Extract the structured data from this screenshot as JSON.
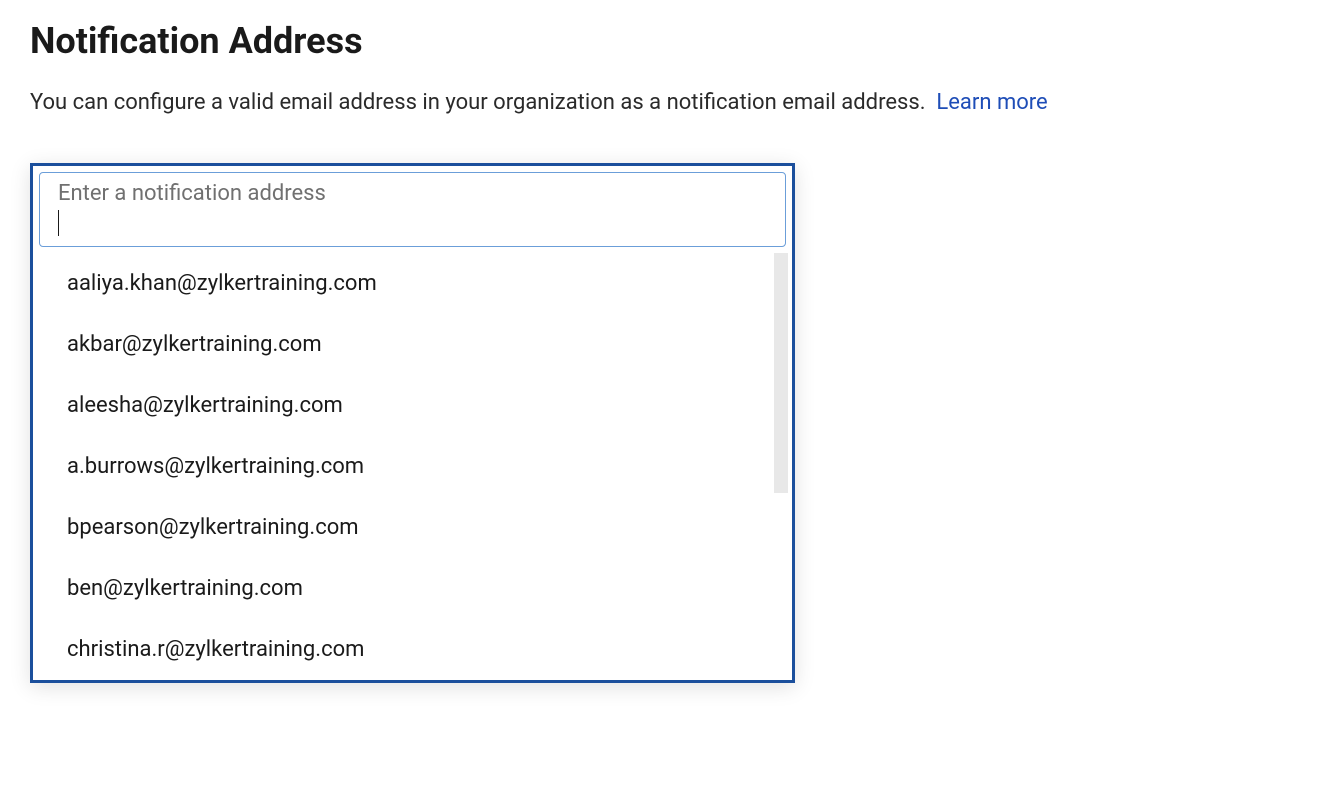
{
  "header": {
    "title": "Notification Address",
    "description": "You can configure a valid email address in your organization as a notification email address.",
    "learn_more_label": "Learn more"
  },
  "input": {
    "label": "Enter a notification address",
    "value": ""
  },
  "suggestions": [
    "aaliya.khan@zylkertraining.com",
    "akbar@zylkertraining.com",
    "aleesha@zylkertraining.com",
    "a.burrows@zylkertraining.com",
    "bpearson@zylkertraining.com",
    "ben@zylkertraining.com",
    "christina.r@zylkertraining.com"
  ]
}
